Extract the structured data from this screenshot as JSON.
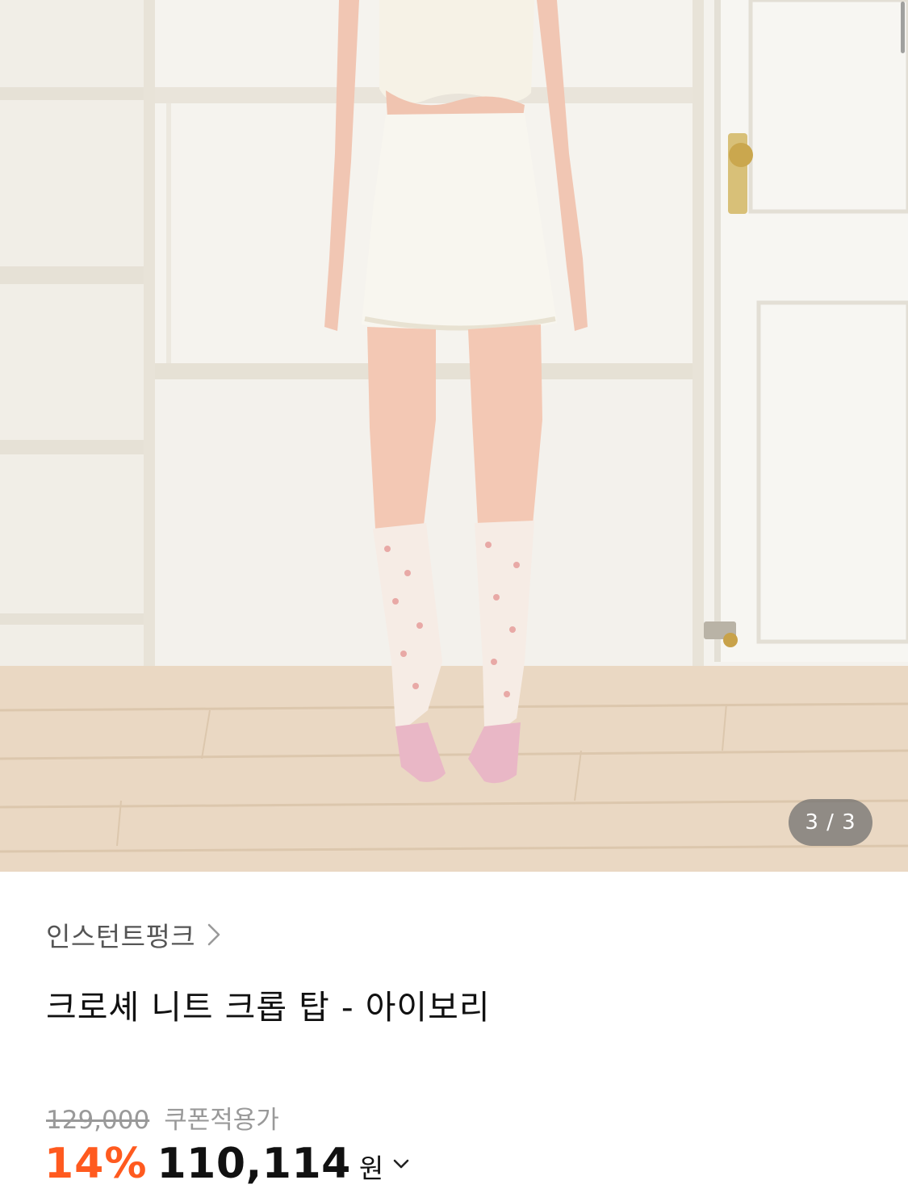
{
  "gallery": {
    "current_page": 3,
    "total_pages": 3,
    "counter_text": "3 / 3",
    "image_alt_icon": "product-photo"
  },
  "product": {
    "brand": "인스턴트펑크",
    "title": "크로셰 니트 크롭 탑 - 아이보리",
    "original_price": "129,000",
    "coupon_label": "쿠폰적용가",
    "discount_rate": "14%",
    "final_price": "110,114",
    "currency": "원"
  },
  "colors": {
    "accent_discount": "#ff5a1f",
    "muted_text": "#999999",
    "primary_text": "#111111"
  },
  "icons": {
    "brand_arrow": "chevron-right-icon",
    "price_toggle": "chevron-down-icon"
  }
}
